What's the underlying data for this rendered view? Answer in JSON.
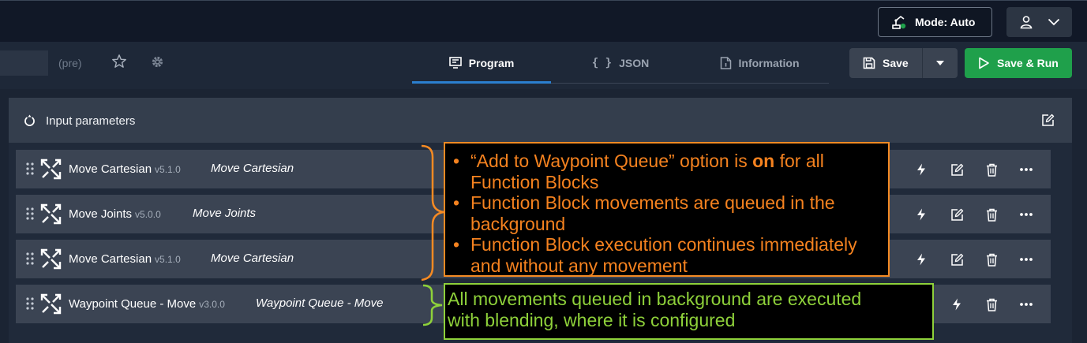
{
  "header": {
    "mode_label": "Mode: Auto"
  },
  "subbar": {
    "pre_label": "(pre)",
    "tabs": [
      {
        "label": "Program",
        "icon": "monitor-icon",
        "active": true
      },
      {
        "label": "JSON",
        "icon": "braces-icon",
        "active": false
      },
      {
        "label": "Information",
        "icon": "info-document-icon",
        "active": false
      }
    ],
    "save_label": "Save",
    "run_label": "Save & Run"
  },
  "panel": {
    "header_label": "Input parameters"
  },
  "rows": [
    {
      "name": "Move Cartesian",
      "version": "v5.1.0",
      "alias": "Move Cartesian"
    },
    {
      "name": "Move Joints",
      "version": "v5.0.0",
      "alias": "Move Joints"
    },
    {
      "name": "Move Cartesian",
      "version": "v5.1.0",
      "alias": "Move Cartesian"
    },
    {
      "name": "Waypoint Queue - Move",
      "version": "v3.0.0",
      "alias": "Waypoint Queue - Move"
    }
  ],
  "annotations": {
    "orange_bullets": [
      {
        "before": "“Add to Waypoint Queue” option is ",
        "bold": "on",
        "after": " for all Function Blocks"
      },
      {
        "before": "Function Block movements are queued in the background",
        "bold": "",
        "after": ""
      },
      {
        "before": "Function Block execution continues immediately and without any movement",
        "bold": "",
        "after": ""
      }
    ],
    "green_text": "All movements queued in background are executed with blending, where it is configured"
  },
  "colors": {
    "accent_blue": "#2b7fd0",
    "run_green": "#1fa04b",
    "annotation_orange": "#f58a23",
    "annotation_green": "#8ed13a"
  }
}
